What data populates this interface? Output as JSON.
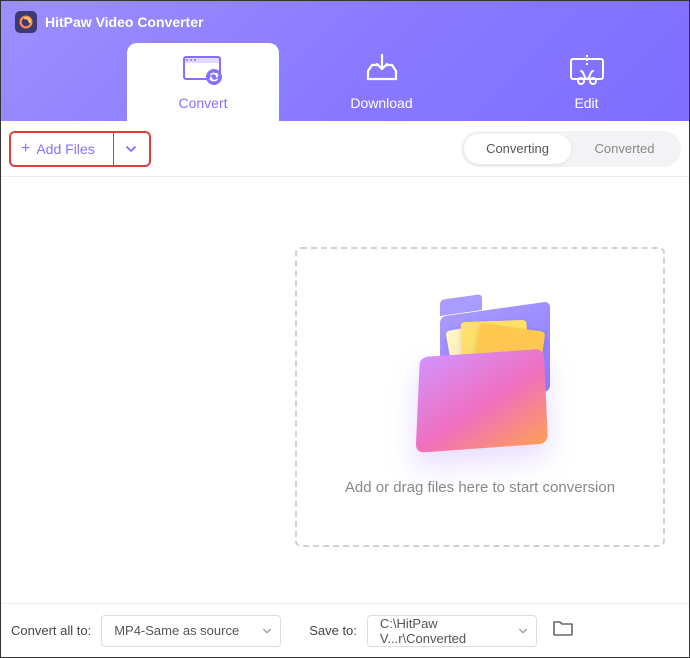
{
  "app": {
    "title": "HitPaw Video Converter"
  },
  "tabs": {
    "convert": "Convert",
    "download": "Download",
    "edit": "Edit"
  },
  "toolbar": {
    "add_files": "Add Files"
  },
  "segmented": {
    "converting": "Converting",
    "converted": "Converted"
  },
  "dropzone": {
    "hint": "Add or drag files here to start conversion"
  },
  "footer": {
    "convert_all_label": "Convert all to:",
    "format_value": "MP4-Same as source",
    "save_to_label": "Save to:",
    "path_value": "C:\\HitPaw V...r\\Converted"
  }
}
